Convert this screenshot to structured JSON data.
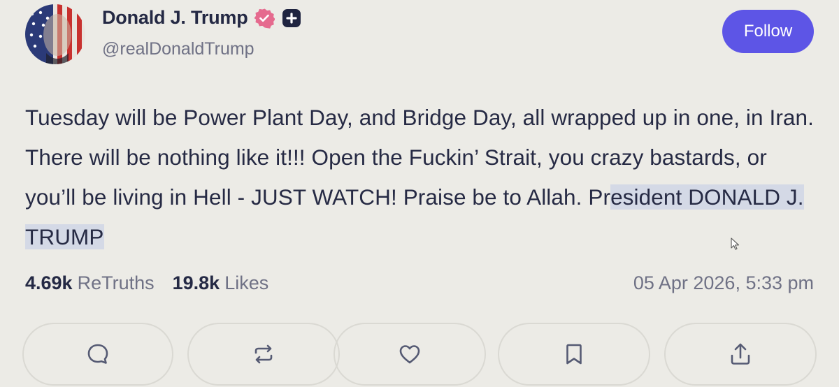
{
  "user": {
    "display_name": "Donald J. Trump",
    "handle": "@realDonaldTrump",
    "verified_badge_icon": "verified-badge-icon",
    "extra_badge_icon": "plus-badge-icon"
  },
  "follow_button": {
    "label": "Follow"
  },
  "post": {
    "text_before_highlight": "Tuesday will be Power Plant Day, and Bridge Day, all wrapped up in one, in Iran. There will be nothing like it!!! Open the Fuckin’ Strait, you crazy bastards, or you’ll be living in Hell - JUST WATCH! Praise be to Allah. Pr",
    "text_highlighted": "esident DONALD J. TRUMP"
  },
  "stats": {
    "retruths_count": "4.69k",
    "retruths_label": "ReTruths",
    "likes_count": "19.8k",
    "likes_label": "Likes"
  },
  "timestamp": "05 Apr 2026, 5:33 pm",
  "actions": [
    {
      "name": "reply",
      "icon": "comment-icon"
    },
    {
      "name": "retruth",
      "icon": "repost-icon"
    },
    {
      "name": "like",
      "icon": "heart-icon"
    },
    {
      "name": "bookmark",
      "icon": "bookmark-icon"
    },
    {
      "name": "share",
      "icon": "share-icon"
    }
  ],
  "colors": {
    "background": "#ecebe6",
    "accent": "#5d55e6",
    "verified": "#e56a8e",
    "text": "#262a44",
    "muted": "#6f7185",
    "highlight": "#d4d9e6"
  }
}
